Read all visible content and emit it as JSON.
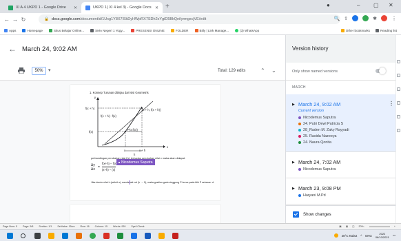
{
  "browser": {
    "tabs": [
      {
        "label": "XI A 4 UKPD 1 - Google Drive",
        "favicon_color": "#1fa463"
      },
      {
        "label": "UKPD 1( XI 4 kel 3) - Google Docs",
        "favicon_color": "#4285f4"
      }
    ],
    "new_tab": "+",
    "window_controls": [
      "–",
      "▢",
      "✕"
    ],
    "url_host": "docs.google.com",
    "url_path": "/document/d/1Uxg1Y8X7lSkDyHWpRX7SDh2xYgiD5BkQnilyrmgxcjVE/edit",
    "bookmarks": [
      "Apps",
      "Homepage",
      "Situs Belajar Online...",
      "SMA Negeri 1 Yogy...",
      "PRESENSI ONLINE",
      "FOLDER",
      "Bitly | Link Manage...",
      "(3) WhatsApp"
    ],
    "bookmarks_right": [
      "Other bookmarks",
      "Reading list"
    ]
  },
  "doc": {
    "title": "March 24, 9:02 AM",
    "zoom": "50%",
    "total_edits": "Total: 129 edits",
    "content": {
      "heading": "1.  Konsep Turunan ditinjau dari sisi Geometris",
      "graph_labels": {
        "fxh": "f(x + h)",
        "fx": "f(x)",
        "p1": "(x + h, f(x + h))",
        "p2": "P(x,f(x))",
        "x": "x",
        "xh": "x + h",
        "h": "h",
        "fxh_minus_fx": "f(x + h) - f(x)",
        "y": "y",
        "axis_x": "x"
      },
      "para1": "perbandingan perubahan nilai f(x) terhadap perubahan nilai x maka akan didapat:",
      "formula_left": "Δy",
      "formula_right": "f(x+h) − f(x)",
      "formula_den_left": "Δx",
      "formula_den_right": "(x+h) − (x)",
      "highlight_name": "Nicodemus Saputra",
      "para2": "Jika domin nilai h (selisih x) mendekati nol (h → 0), maka gradien garis singgung P kurva pada titik P sebesar: d."
    }
  },
  "version_history": {
    "title": "Version history",
    "filter_label": "Only show named versions",
    "month": "MARCH",
    "entries": [
      {
        "date": "March 24, 9:02 AM",
        "current": "Current version",
        "users": [
          {
            "name": "Nicodemus Saputra",
            "color": "#7e57c2"
          },
          {
            "name": "24. Putri Dewi Patricia S",
            "color": "#e8710a"
          },
          {
            "name": "28_Raden M. Zaky Rayyadi",
            "color": "#12b5cb"
          },
          {
            "name": "25. Rasida Nazeeya",
            "color": "#d81b60"
          },
          {
            "name": "24. Naura Qonita",
            "color": "#1e8e3e"
          }
        ]
      },
      {
        "date": "March 24, 7:02 AM",
        "users": [
          {
            "name": "Nicodemus Saputra",
            "color": "#7e57c2"
          }
        ]
      },
      {
        "date": "March 23, 9:08 PM",
        "users": [
          {
            "name": "Haryani M.Pd",
            "color": "#1a73e8"
          }
        ]
      }
    ],
    "show_changes": "Show changes"
  },
  "statusbar": {
    "left": [
      "Page Num: 5",
      "Page: 5/8",
      "Section: 1/1",
      "SetValue: 15cm",
      "Row: 16",
      "Column: 15",
      "Words: 939",
      "Spell Check"
    ],
    "right": "20% -"
  },
  "taskbar": {
    "weather": "28°C  Kabut",
    "lang": "ENG",
    "time": "2022",
    "date": "06/10/2021"
  }
}
